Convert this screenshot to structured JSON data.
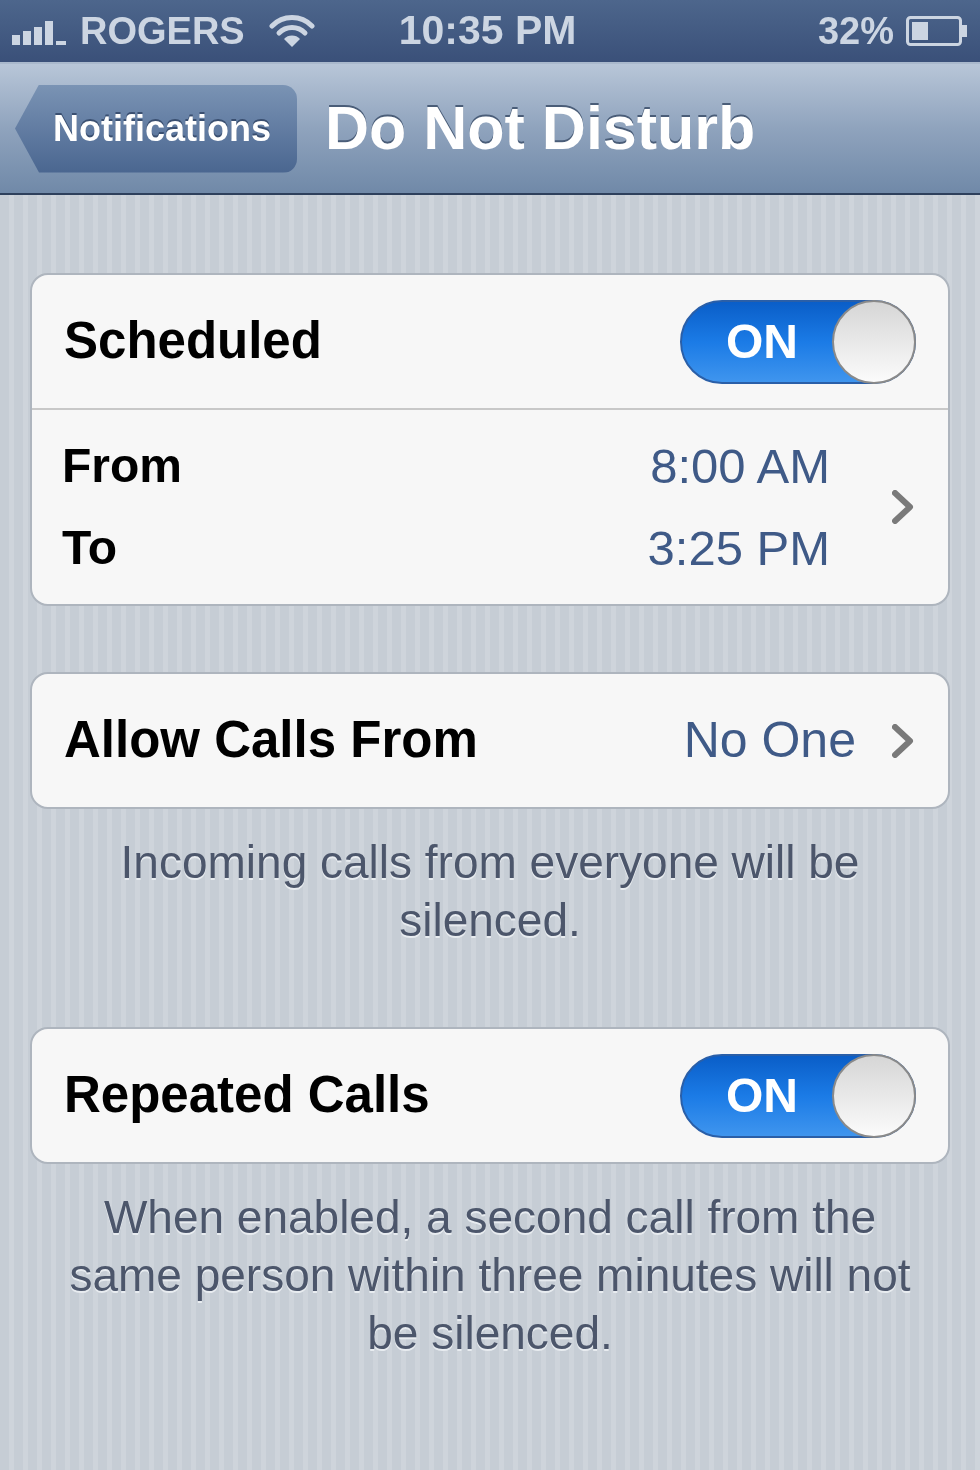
{
  "status_bar": {
    "carrier": "ROGERS",
    "time": "10:35 PM",
    "battery": "32%"
  },
  "nav_bar": {
    "back_button": "Notifications",
    "title": "Do Not Disturb"
  },
  "groups": [
    {
      "rows": [
        {
          "kind": "switch",
          "label": "Scheduled",
          "on": true,
          "switch_text": "ON"
        },
        {
          "kind": "time_range",
          "from_label": "From",
          "from_value": "8:00 AM",
          "to_label": "To",
          "to_value": "3:25 PM"
        }
      ]
    },
    {
      "rows": [
        {
          "kind": "detail",
          "label": "Allow Calls From",
          "value": "No One"
        }
      ],
      "footer": "Incoming calls from everyone will be silenced."
    },
    {
      "rows": [
        {
          "kind": "switch",
          "label": "Repeated Calls",
          "on": true,
          "switch_text": "ON"
        }
      ],
      "footer": "When enabled, a second call from the same person within three minutes will not be silenced."
    }
  ]
}
